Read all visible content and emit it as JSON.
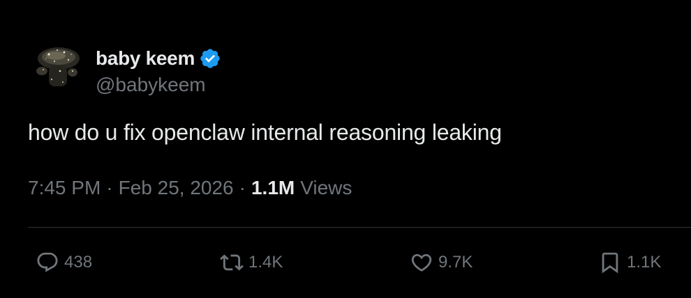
{
  "author": {
    "display_name": "baby keem",
    "handle": "@babykeem",
    "verified": true
  },
  "tweet": {
    "text": "how do u fix openclaw internal reasoning leaking",
    "time": "7:45 PM",
    "separator": "·",
    "date": "Feb 25, 2026",
    "views_count": "1.1M",
    "views_label": "Views"
  },
  "actions": {
    "reply": {
      "icon": "reply-icon",
      "count": "438"
    },
    "retweet": {
      "icon": "retweet-icon",
      "count": "1.4K"
    },
    "like": {
      "icon": "heart-icon",
      "count": "9.7K"
    },
    "bookmark": {
      "icon": "bookmark-icon",
      "count": "1.1K"
    }
  },
  "colors": {
    "background": "#000000",
    "text_primary": "#e7e9ea",
    "text_secondary": "#71767b",
    "divider": "#2f3336",
    "verified_badge": "#1d9bf0"
  }
}
